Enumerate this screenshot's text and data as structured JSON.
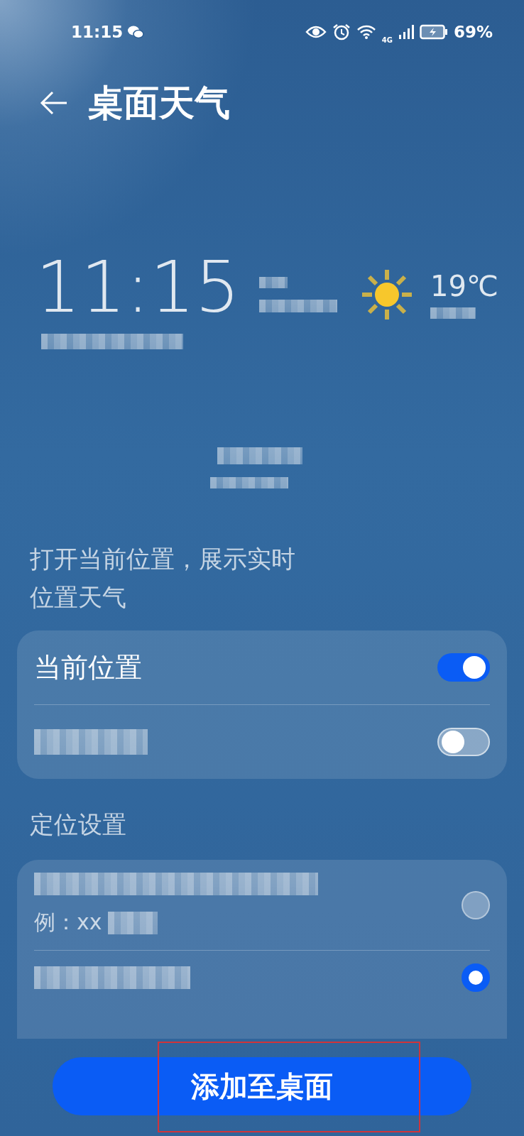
{
  "status_bar": {
    "time": "11:15",
    "network": "4G",
    "battery": "69%"
  },
  "header": {
    "title": "桌面天气"
  },
  "preview": {
    "time": "11:15",
    "temperature": "19℃"
  },
  "description": "打开当前位置，展示实时位置天气",
  "toggles": [
    {
      "label": "当前位置",
      "redacted": false,
      "on": true
    },
    {
      "redacted": true,
      "on": false
    }
  ],
  "location_section": {
    "title": "定位设置",
    "options": [
      {
        "redacted_title": true,
        "example": "例：xx",
        "selected": false
      },
      {
        "redacted_title": true,
        "selected": true
      }
    ]
  },
  "add_button": {
    "label": "添加至桌面",
    "highlighted": true
  }
}
